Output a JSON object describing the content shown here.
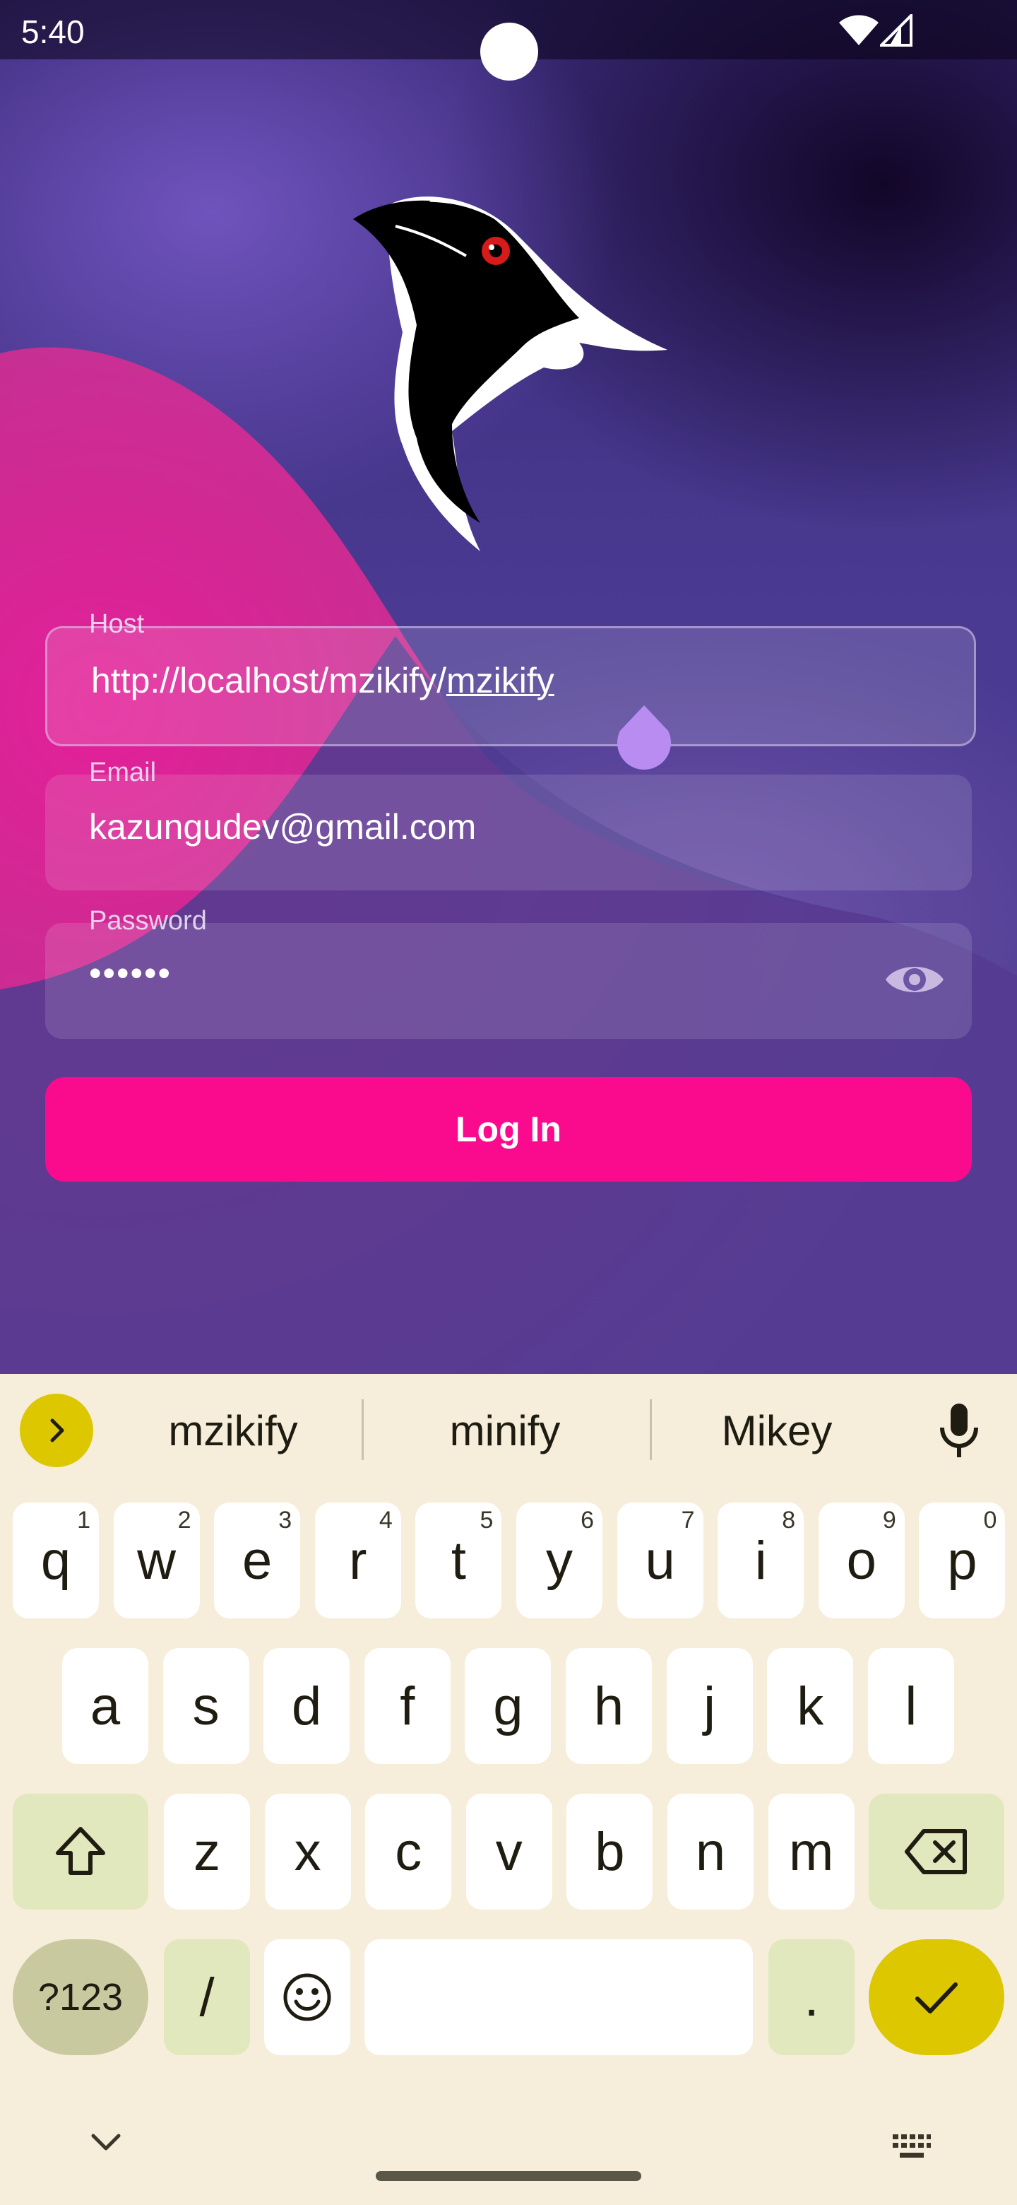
{
  "status_bar": {
    "time": "5:40"
  },
  "form": {
    "host": {
      "label": "Host",
      "value_prefix": "http://localhost/mzikify/",
      "value_underlined": "mzikify"
    },
    "email": {
      "label": "Email",
      "value": "kazungudev@gmail.com"
    },
    "password": {
      "label": "Password",
      "value": "••••••"
    },
    "login_label": "Log In"
  },
  "colors": {
    "accent_pink": "#fa0b8e",
    "cursor_purple": "#b98cf2",
    "keyboard_bg": "#f6eedb",
    "keyboard_accent": "#dcc700"
  },
  "keyboard": {
    "suggestions": [
      "mzikify",
      "minify",
      "Mikey"
    ],
    "row1": [
      {
        "k": "q",
        "h": "1"
      },
      {
        "k": "w",
        "h": "2"
      },
      {
        "k": "e",
        "h": "3"
      },
      {
        "k": "r",
        "h": "4"
      },
      {
        "k": "t",
        "h": "5"
      },
      {
        "k": "y",
        "h": "6"
      },
      {
        "k": "u",
        "h": "7"
      },
      {
        "k": "i",
        "h": "8"
      },
      {
        "k": "o",
        "h": "9"
      },
      {
        "k": "p",
        "h": "0"
      }
    ],
    "row2": [
      "a",
      "s",
      "d",
      "f",
      "g",
      "h",
      "j",
      "k",
      "l"
    ],
    "row3": [
      "z",
      "x",
      "c",
      "v",
      "b",
      "n",
      "m"
    ],
    "symbols_label": "?123",
    "slash_label": "/",
    "period_label": "."
  },
  "icons": {
    "logo": "bird-logo-icon",
    "eye": "eye-icon",
    "expand": "chevron-right-icon",
    "mic": "mic-icon",
    "shift": "shift-icon",
    "backspace": "backspace-icon",
    "emoji": "emoji-icon",
    "enter": "check-icon",
    "hide": "chevron-down-icon",
    "switch": "keyboard-icon"
  }
}
